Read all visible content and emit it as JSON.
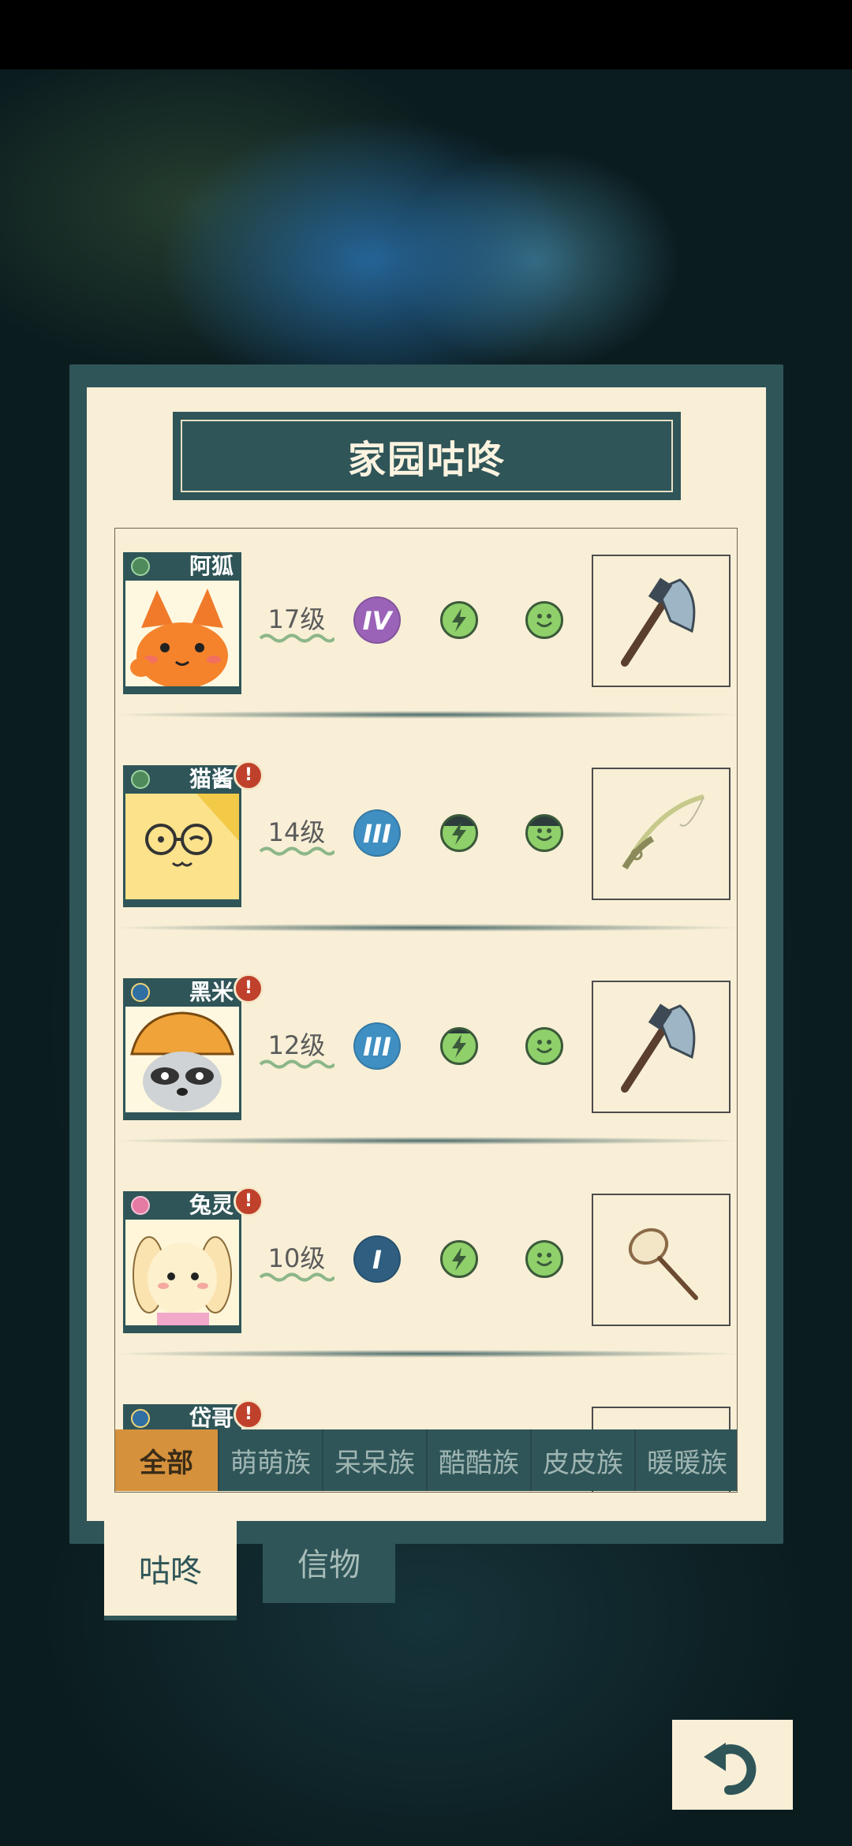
{
  "title": "家园咕咚",
  "colors": {
    "panel": "#f8efd6",
    "frame": "#2f5558",
    "active_tab": "#d6913c",
    "alert": "#c0412b"
  },
  "characters": [
    {
      "name": "阿狐",
      "level": "17级",
      "rank": "IV",
      "rank_color": "#9b63b8",
      "tribe_icon": "leaf-icon",
      "alert": false,
      "tool": "axe-icon"
    },
    {
      "name": "猫酱",
      "level": "14级",
      "rank": "III",
      "rank_color": "#3f8fc2",
      "tribe_icon": "leaf-icon",
      "alert": true,
      "alert_text": "!",
      "tool": "fishing-rod-icon"
    },
    {
      "name": "黑米",
      "level": "12级",
      "rank": "III",
      "rank_color": "#3f8fc2",
      "tribe_icon": "moon-icon",
      "alert": true,
      "alert_text": "!",
      "tool": "axe-icon"
    },
    {
      "name": "兔灵",
      "level": "10级",
      "rank": "I",
      "rank_color": "#2f5e80",
      "tribe_icon": "heart-icon",
      "alert": true,
      "alert_text": "!",
      "tool": "bug-net-icon"
    },
    {
      "name": "岱哥",
      "tribe_icon": "moon-icon",
      "alert": true,
      "alert_text": "!"
    }
  ],
  "filter_tabs": [
    "全部",
    "萌萌族",
    "呆呆族",
    "酷酷族",
    "皮皮族",
    "暖暖族"
  ],
  "active_filter": "全部",
  "bottom_tabs": [
    "咕咚",
    "信物"
  ],
  "active_bottom_tab": "咕咚",
  "back_icon": "undo-arrow-icon"
}
